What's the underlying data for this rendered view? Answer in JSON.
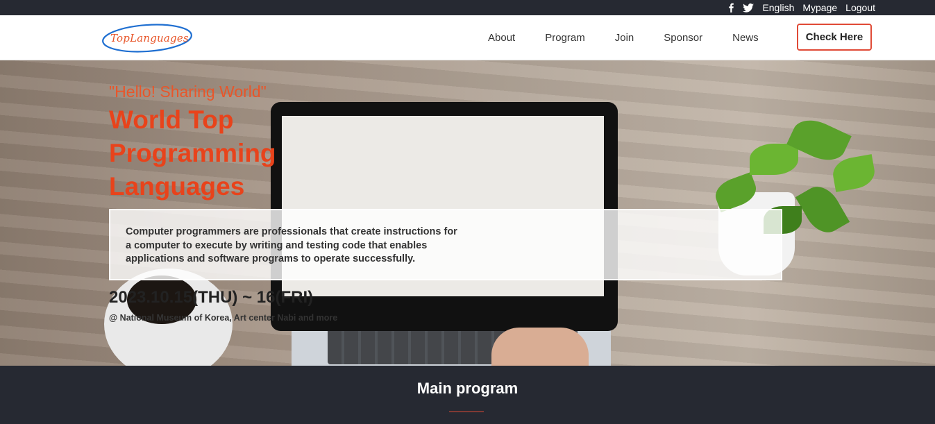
{
  "topbar": {
    "icons": [
      "facebook-icon",
      "twitter-icon"
    ],
    "links": [
      "English",
      "Mypage",
      "Logout"
    ]
  },
  "header": {
    "logo_text": "TopLanguages",
    "nav": [
      "About",
      "Program",
      "Join",
      "Sponsor",
      "News"
    ],
    "cta_label": "Check Here",
    "accent_color": "#e04a36"
  },
  "hero": {
    "subtitle": "\"Hello! Sharing World\"",
    "headline_lines": [
      "World Top",
      "Programming",
      "Languages"
    ],
    "description_lines": [
      "Computer programmers are professionals that create instructions for",
      "a computer to execute by writing and testing code that enables",
      "applications and software programs to operate successfully."
    ],
    "date": "2023.10.15(THU) ~ 16(FRI)",
    "venue": "@ National Museum of Korea, Art center Nabi and more"
  },
  "program": {
    "title": "Main program"
  }
}
